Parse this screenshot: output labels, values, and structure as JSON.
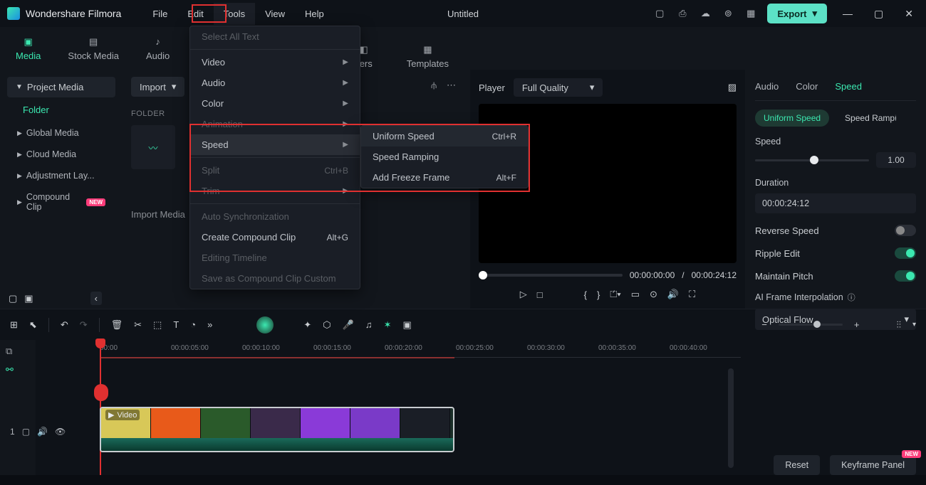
{
  "app_name": "Wondershare Filmora",
  "menus": [
    "File",
    "Edit",
    "Tools",
    "View",
    "Help"
  ],
  "active_menu_index": 2,
  "doc_title": "Untitled",
  "export_label": "Export",
  "library_tabs": [
    {
      "label": "Media",
      "icon": "media"
    },
    {
      "label": "Stock Media",
      "icon": "stock"
    },
    {
      "label": "Audio",
      "icon": "audio"
    },
    {
      "label": "",
      "icon": "markers",
      "suffix": "kers"
    },
    {
      "label": "Templates",
      "icon": "templates"
    }
  ],
  "active_library_tab": 0,
  "sidebar": {
    "project_media": "Project Media",
    "folder": "Folder",
    "items": [
      "Global Media",
      "Cloud Media",
      "Adjustment Lay...",
      "Compound Clip"
    ],
    "compound_new": "NEW"
  },
  "center": {
    "import_label": "Import",
    "folder_header": "FOLDER",
    "import_media": "Import Media"
  },
  "preview": {
    "player_label": "Player",
    "quality": "Full Quality",
    "current_time": "00:00:00:00",
    "total_time": "00:00:24:12"
  },
  "right_panel": {
    "tabs": [
      "Audio",
      "Color",
      "Speed"
    ],
    "active_tab": 2,
    "subtabs": [
      "Uniform Speed",
      "Speed Ramping"
    ],
    "active_subtab": 0,
    "speed_label": "Speed",
    "speed_value": "1.00",
    "duration_label": "Duration",
    "duration_value": "00:00:24:12",
    "reverse_label": "Reverse Speed",
    "ripple_label": "Ripple Edit",
    "pitch_label": "Maintain Pitch",
    "reverse_on": false,
    "ripple_on": true,
    "pitch_on": true,
    "ai_interp_label": "AI Frame Interpolation",
    "ai_interp_value": "Optical Flow",
    "reset": "Reset",
    "keyframe_panel": "Keyframe Panel",
    "keyframe_new": "NEW"
  },
  "tools_menu": {
    "select_all": "Select All Text",
    "items": [
      "Video",
      "Audio",
      "Color",
      "Animation",
      "Speed"
    ],
    "split": "Split",
    "split_kbd": "Ctrl+B",
    "trim": "Trim",
    "auto_sync": "Auto Synchronization",
    "create_compound": "Create Compound Clip",
    "create_kbd": "Alt+G",
    "editing_timeline": "Editing Timeline",
    "save_compound": "Save as Compound Clip Custom"
  },
  "speed_submenu": {
    "uniform": "Uniform Speed",
    "uniform_kbd": "Ctrl+R",
    "ramping": "Speed Ramping",
    "freeze": "Add Freeze Frame",
    "freeze_kbd": "Alt+F"
  },
  "timeline": {
    "ticks": [
      "00:00",
      "00:00:05:00",
      "00:00:10:00",
      "00:00:15:00",
      "00:00:20:00",
      "00:00:25:00",
      "00:00:30:00",
      "00:00:35:00",
      "00:00:40:00"
    ],
    "track_label": "Video",
    "track_index": "1"
  },
  "thumb_colors": [
    "#d8c858",
    "#e85a1a",
    "#2a5a2a",
    "#3a2a4a",
    "#8a3ad8",
    "#7a3ac8"
  ]
}
